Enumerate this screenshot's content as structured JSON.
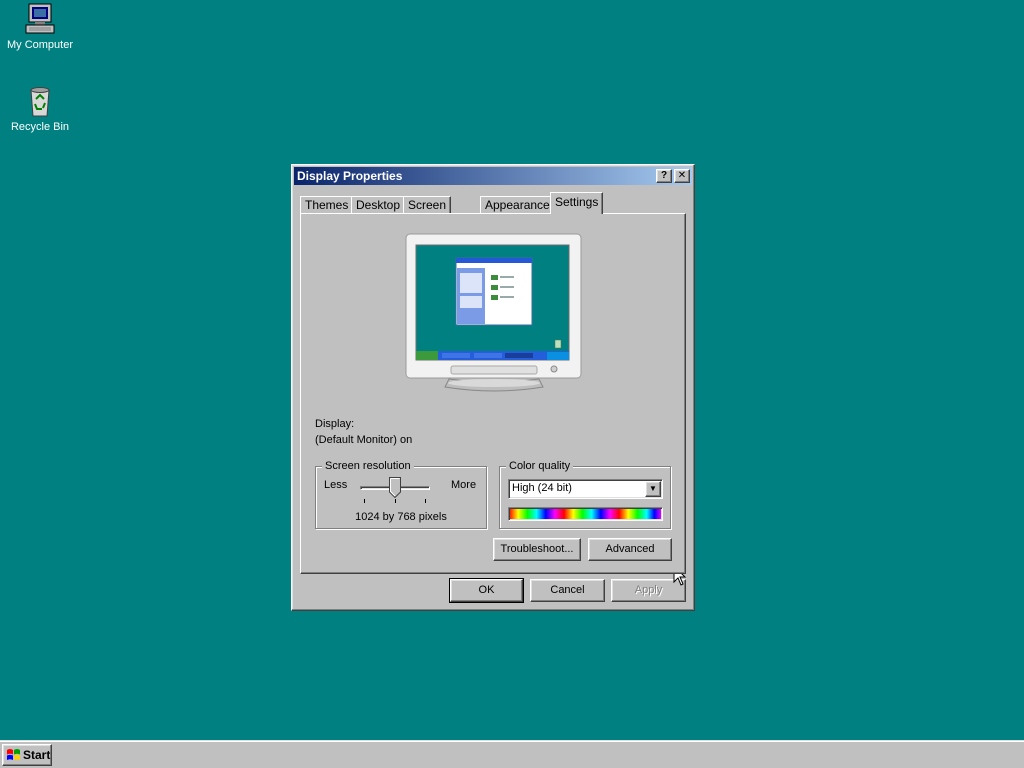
{
  "desktop": {
    "icons": [
      {
        "label": "My Computer",
        "icon": "computer-icon"
      },
      {
        "label": "Recycle Bin",
        "icon": "recycle-bin-icon"
      }
    ]
  },
  "dialog": {
    "title": "Display Properties",
    "help_glyph": "?",
    "close_glyph": "✕",
    "tabs": [
      {
        "label": "Themes"
      },
      {
        "label": "Desktop"
      },
      {
        "label": "Screen Saver"
      },
      {
        "label": "Appearance"
      },
      {
        "label": "Settings",
        "active": true
      }
    ],
    "display_label": "Display:",
    "display_value": "(Default Monitor) on",
    "resolution": {
      "title": "Screen resolution",
      "less": "Less",
      "more": "More",
      "value_text": "1024 by 768 pixels",
      "slider_level": 0.45
    },
    "color_quality": {
      "title": "Color quality",
      "selected": "High (24 bit)"
    },
    "buttons": {
      "troubleshoot": "Troubleshoot...",
      "advanced": "Advanced",
      "ok": "OK",
      "cancel": "Cancel",
      "apply": "Apply"
    }
  },
  "taskbar": {
    "start_label": "Start"
  },
  "colors": {
    "desktop": "#008080",
    "title_start": "#0a246a",
    "title_end": "#a6caf0",
    "face": "#c0c0c0"
  }
}
